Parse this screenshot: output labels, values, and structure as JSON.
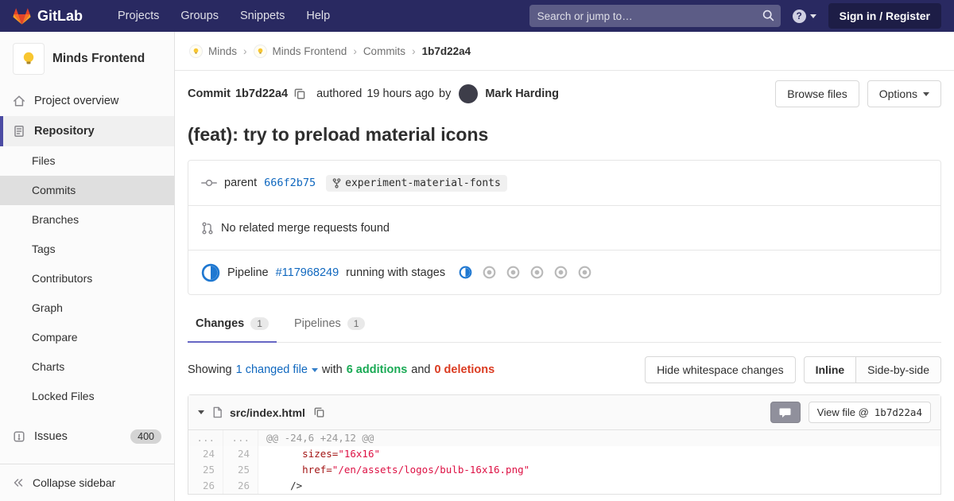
{
  "navbar": {
    "brand": "GitLab",
    "menu": [
      {
        "label": "Projects"
      },
      {
        "label": "Groups"
      },
      {
        "label": "Snippets"
      },
      {
        "label": "Help"
      }
    ],
    "search_placeholder": "Search or jump to…",
    "help_icon": "?",
    "sign_in_label": "Sign in / Register"
  },
  "sidebar": {
    "project_name": "Minds Frontend",
    "overview_label": "Project overview",
    "repository_label": "Repository",
    "repo_items": [
      {
        "label": "Files"
      },
      {
        "label": "Commits",
        "active": true
      },
      {
        "label": "Branches"
      },
      {
        "label": "Tags"
      },
      {
        "label": "Contributors"
      },
      {
        "label": "Graph"
      },
      {
        "label": "Compare"
      },
      {
        "label": "Charts"
      },
      {
        "label": "Locked Files"
      }
    ],
    "issues_label": "Issues",
    "issues_count": "400",
    "collapse_label": "Collapse sidebar"
  },
  "breadcrumb": {
    "separator": "›",
    "items": [
      {
        "label": "Minds"
      },
      {
        "label": "Minds Frontend"
      },
      {
        "label": "Commits"
      },
      {
        "label": "1b7d22a4"
      }
    ]
  },
  "commit": {
    "label": "Commit",
    "sha": "1b7d22a4",
    "authored_prefix": "authored",
    "time": "19 hours ago",
    "by": "by",
    "author": "Mark Harding",
    "browse_files_label": "Browse files",
    "options_label": "Options",
    "title": "(feat): try to preload material icons",
    "parent_label": "parent",
    "parent_sha": "666f2b75",
    "branch": "experiment-material-fonts",
    "mr_text": "No related merge requests found",
    "pipeline_prefix": "Pipeline",
    "pipeline_id": "#117968249",
    "pipeline_suffix": "running with stages",
    "pipeline_stages": [
      "running",
      "created",
      "created",
      "created",
      "created",
      "created"
    ]
  },
  "tabs": {
    "changes_label": "Changes",
    "changes_count": "1",
    "pipelines_label": "Pipelines",
    "pipelines_count": "1"
  },
  "diff": {
    "showing_label": "Showing",
    "changed_files": "1 changed file",
    "with_label": "with",
    "additions": "6 additions",
    "and_label": "and",
    "deletions": "0 deletions",
    "hide_whitespace_label": "Hide whitespace changes",
    "inline_label": "Inline",
    "side_by_side_label": "Side-by-side",
    "file": {
      "name": "src/index.html",
      "view_file_label": "View file @",
      "view_file_sha": "1b7d22a4"
    },
    "lines": [
      {
        "type": "hunk",
        "old": "...",
        "new": "...",
        "t0": "@@ -24,6 +24,12 @@"
      },
      {
        "type": "context",
        "old": "24",
        "new": "24",
        "t0": "      ",
        "t1": "sizes=",
        "t2": "\"16x16\""
      },
      {
        "type": "context",
        "old": "25",
        "new": "25",
        "t0": "      ",
        "t1": "href=",
        "t2": "\"/en/assets/logos/bulb-16x16.png\""
      },
      {
        "type": "context",
        "old": "26",
        "new": "26",
        "t0": "    />"
      }
    ]
  },
  "colors": {
    "navbar_bg": "#292961",
    "brand_orange": "#fc6d26",
    "link_blue": "#1068bf",
    "additions_green": "#1aaa55",
    "deletions_red": "#db3b21",
    "pipeline_running_blue": "#1f78d1",
    "active_tab_indigo": "#6666c4",
    "sidebar_active_border": "#4b4ba3"
  }
}
